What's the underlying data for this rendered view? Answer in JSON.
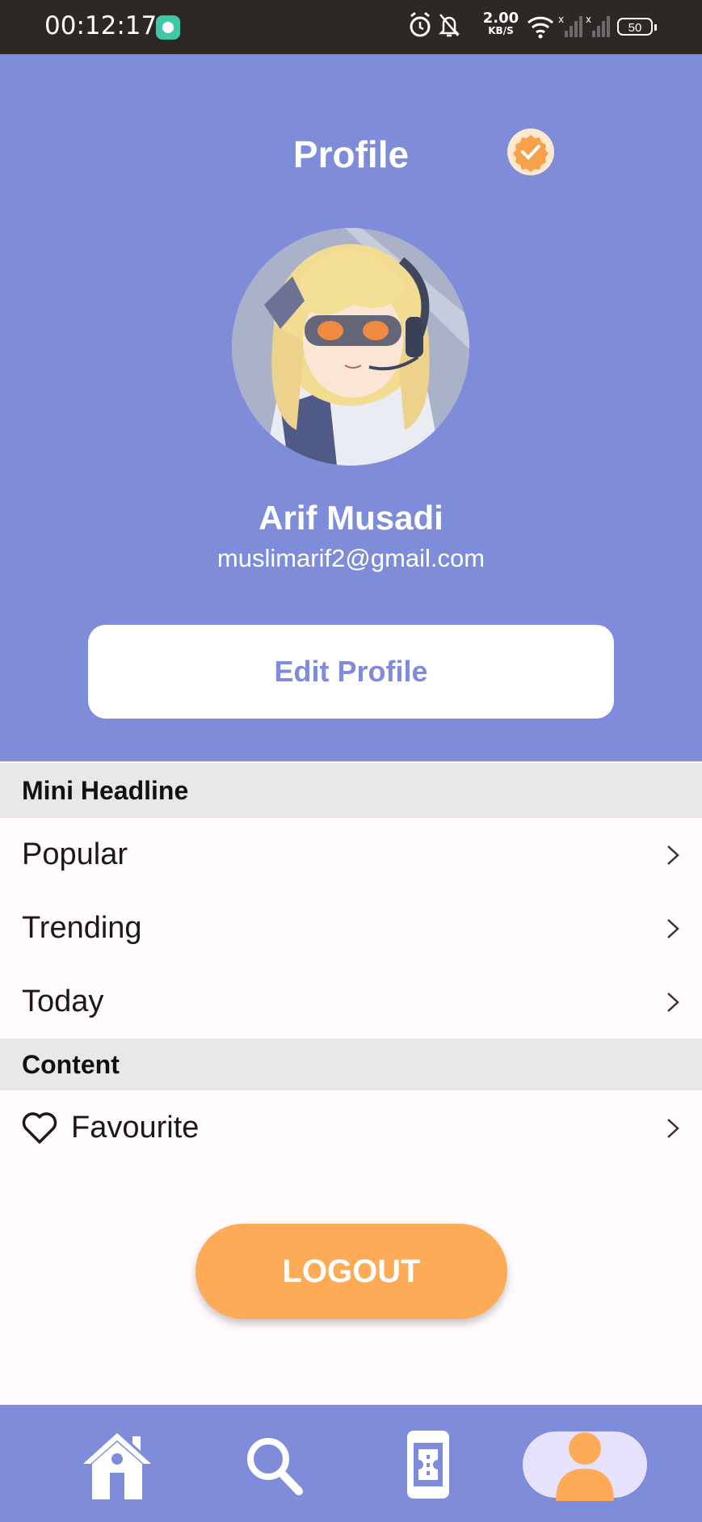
{
  "status_bar": {
    "time": "00:12:17",
    "net_speed_value": "2.00",
    "net_speed_unit": "KB/S",
    "battery": "50"
  },
  "header": {
    "title": "Profile",
    "name": "Arif Musadi",
    "email": "muslimarif2@gmail.com",
    "edit_label": "Edit Profile"
  },
  "sections": {
    "mini_headline": "Mini Headline",
    "mini_items": [
      "Popular",
      "Trending",
      "Today"
    ],
    "content": "Content",
    "content_items": [
      "Favourite"
    ]
  },
  "actions": {
    "logout_label": "LOGOUT"
  },
  "bottom_nav": {
    "items": [
      "home-icon",
      "search-icon",
      "ticket-icon",
      "profile-icon"
    ],
    "active": "profile-icon"
  },
  "colors": {
    "primary": "#7f8cd9",
    "accent": "#fdab57",
    "section_bg": "#e8e8ea"
  }
}
